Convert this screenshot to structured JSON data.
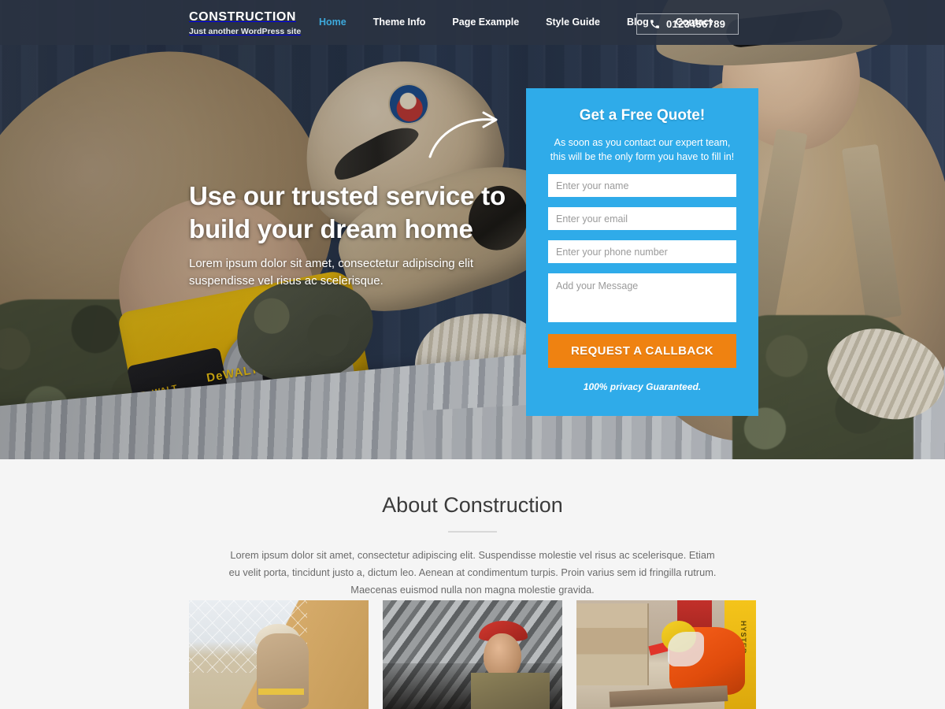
{
  "header": {
    "brand_name": "CONSTRUCTION",
    "brand_tagline": "Just another WordPress site",
    "nav": [
      {
        "label": "Home",
        "active": true
      },
      {
        "label": "Theme Info",
        "active": false
      },
      {
        "label": "Page Example",
        "active": false
      },
      {
        "label": "Style Guide",
        "active": false
      },
      {
        "label": "Blog",
        "active": false
      },
      {
        "label": "Contact",
        "active": false
      }
    ],
    "phone_icon": "phone-icon",
    "phone_number": "0123456789"
  },
  "hero": {
    "title": "Use our trusted service to build your dream home",
    "subtitle": "Lorem ipsum dolor sit amet, consectetur adipiscing elit suspendisse vel risus ac scelerisque.",
    "arrow_icon": "curved-arrow-icon"
  },
  "quote_form": {
    "title": "Get a Free Quote!",
    "description": "As soon as you contact our expert team, this will be the only form you have to fill in!",
    "fields": [
      {
        "name": "name",
        "placeholder": "Enter your name",
        "value": ""
      },
      {
        "name": "email",
        "placeholder": "Enter your email",
        "value": ""
      },
      {
        "name": "phone",
        "placeholder": "Enter your phone number",
        "value": ""
      },
      {
        "name": "message",
        "placeholder": "Add your Message",
        "value": ""
      }
    ],
    "submit_label": "REQUEST A CALLBACK",
    "privacy_note": "100% privacy Guaranteed."
  },
  "about": {
    "title": "About Construction",
    "body": "Lorem ipsum dolor sit amet, consectetur adipiscing elit. Suspendisse molestie vel risus ac scelerisque. Etiam eu velit porta, tincidunt justo a, dictum leo. Aenean at condimentum turpis. Proin varius sem id fringilla rutrum. Maecenas euismod nulla non magna molestie gravida.",
    "thumbnails": [
      {
        "alt": "Worker carrying plywood board at a construction site"
      },
      {
        "alt": "Worker beneath a corrugated metal structure"
      },
      {
        "alt": "Worker in orange protective suit cutting timber near a forklift"
      }
    ]
  },
  "colors": {
    "header_bg": "#2a3342",
    "accent_blue": "#2fabe9",
    "nav_active": "#3da9dc",
    "cta_orange": "#ef8211",
    "section_bg": "#f5f5f5",
    "body_text": "#6b6b6b",
    "heading_text": "#3b3b3b"
  }
}
